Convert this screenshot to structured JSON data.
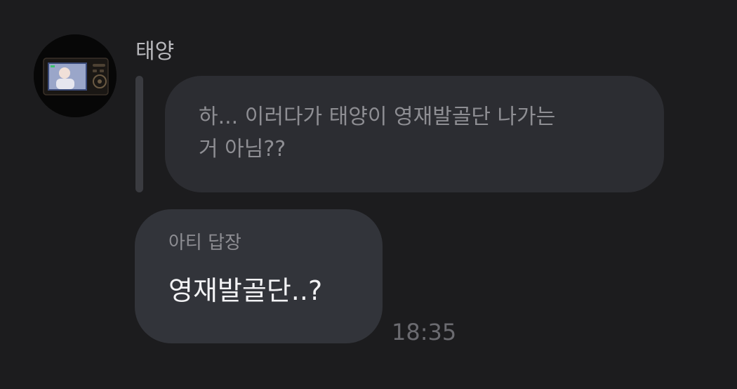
{
  "message": {
    "sender_name": "태양",
    "avatar_icon": "profile-photo-camera-screen",
    "quoted_text": "하... 이러다가 태양이 영재발골단 나가는\n거 아님??",
    "reply_label": "아티 답장",
    "reply_text": "영재발골단..?",
    "timestamp": "18:35"
  },
  "colors": {
    "background": "#1c1c1e",
    "quoted_bubble": "#2c2d32",
    "reply_bubble": "#32343a",
    "quote_bar": "#3a3b40",
    "primary_text": "#f2f2f4",
    "secondary_text": "#8e8e93"
  }
}
